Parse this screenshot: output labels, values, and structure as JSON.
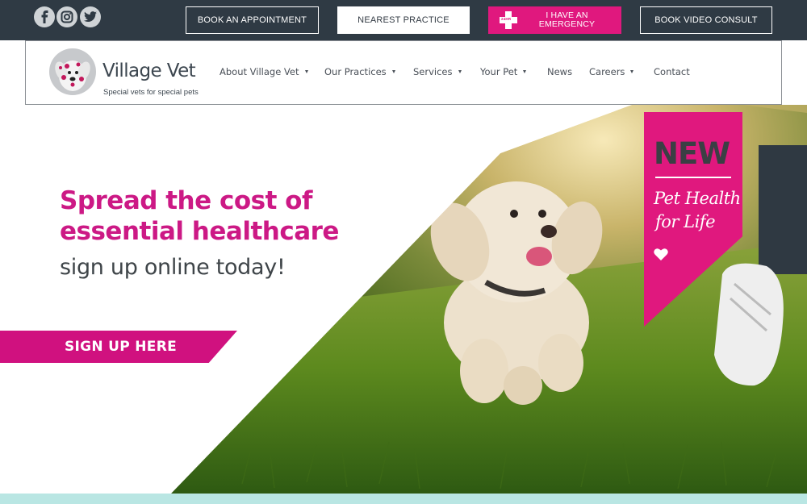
{
  "topbar": {
    "social": [
      "facebook-icon",
      "instagram-icon",
      "twitter-icon"
    ],
    "book_appointment": "BOOK AN APPOINTMENT",
    "nearest_practice": "NEAREST PRACTICE",
    "emergency": "I HAVE AN EMERGENCY",
    "emergency_badge": "24HR",
    "video_consult": "BOOK VIDEO CONSULT"
  },
  "brand": {
    "name": "Village Vet",
    "tagline": "Special vets for special pets"
  },
  "nav": {
    "items": [
      {
        "label": "About Village Vet",
        "dropdown": true
      },
      {
        "label": "Our Practices",
        "dropdown": true
      },
      {
        "label": "Services",
        "dropdown": true
      },
      {
        "label": "Your Pet",
        "dropdown": true
      },
      {
        "label": "News",
        "dropdown": false
      },
      {
        "label": "Careers",
        "dropdown": true
      },
      {
        "label": "Contact",
        "dropdown": false
      }
    ]
  },
  "hero": {
    "headline_line1": "Spread the cost of",
    "headline_line2": "essential healthcare",
    "subline": "sign up online today!",
    "cta": "SIGN UP HERE",
    "banner_new": "NEW",
    "banner_script_line1": "Pet Health",
    "banner_script_line2": "for Life"
  },
  "colors": {
    "topbar": "#2f3a44",
    "accent_pink": "#e0187e",
    "headline_pink": "#cc1985",
    "bottom_strip": "#b9e6e3"
  }
}
